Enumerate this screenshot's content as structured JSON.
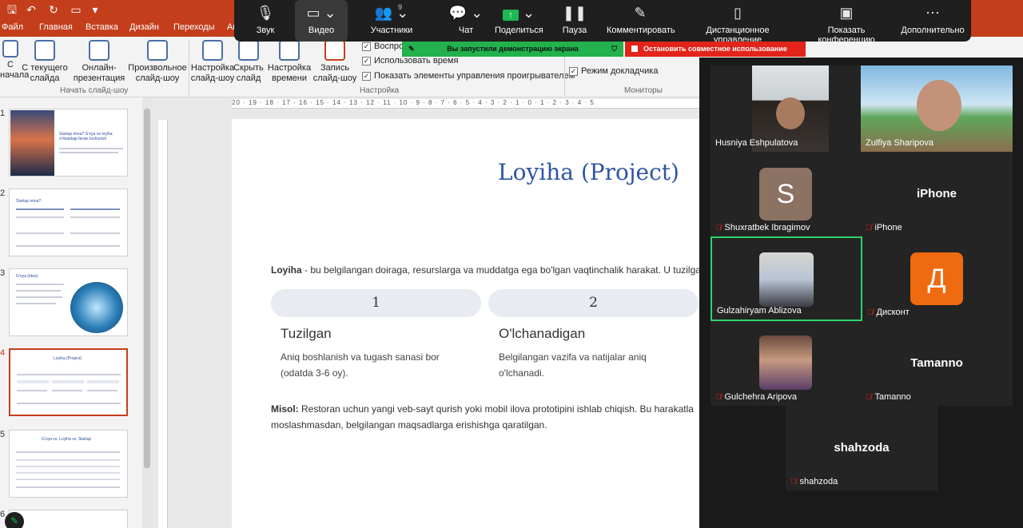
{
  "colors": {
    "accent": "#c43e1c",
    "zoom_green": "#22b14c",
    "zoom_red": "#e2241a",
    "slide_title": "#2f55a4"
  },
  "tabs": [
    "Файл",
    "Главная",
    "Вставка",
    "Дизайн",
    "Переходы",
    "Ан"
  ],
  "ribbon": {
    "from_start": "С\nначала",
    "from_current": "С текущего\nслайда",
    "online": "Онлайн-\nпрезентация",
    "custom": "Произвольное\nслайд-шоу",
    "setup": "Настройка\nслайд-шоу",
    "hide": "Скрыть\nслайд",
    "rehearse": "Настройка\nвремени",
    "record": "Запись\nслайд-шоу",
    "group_start": "Начать слайд-шоу",
    "group_setup": "Настройка",
    "group_monitors": "Мониторы",
    "chk_play": "Воспро",
    "chk_timings": "Использовать время",
    "chk_controls": "Показать элементы управления проигрывателем",
    "chk_presenter": "Режим докладчика"
  },
  "zoom": {
    "sound": "Звук",
    "video": "Видео",
    "participants": "Участники",
    "participants_count": "9",
    "chat": "Чат",
    "share": "Поделиться",
    "pause": "Пауза",
    "annotate": "Комментировать",
    "remote": "Дистанционное управление",
    "show_conf": "Показать конференцию",
    "more": "Дополнительно",
    "sharing_banner": "Вы запустили демонстрацию экрана",
    "stop_banner": "Остановить совместное использование"
  },
  "ruler_h": "20 · 19 · 18 · 17 · 16 · 15 · 14 · 13 · 12 · 11 · 10 · 9 · 8 · 7 · 6 · 5 · 4 · 3 · 2 · 1 · 0 · 1 · 2 · 3 · 4 · 5",
  "thumbnails": [
    {
      "num": "1",
      "title": "Startap nima? G'oya va loyiha o'rtasidagi farqni tushunish"
    },
    {
      "num": "2",
      "title": "Startap nima?"
    },
    {
      "num": "3",
      "title": "G'oya (Idea)"
    },
    {
      "num": "4",
      "title": "Loyiha (Project)"
    },
    {
      "num": "5",
      "title": "G'oya vs. Loyiha vs. Startap"
    },
    {
      "num": "6",
      "title": ""
    }
  ],
  "slide": {
    "title": "Loyiha (Project)",
    "def_bold": "Loyiha",
    "def_rest": " - bu belgilangan doiraga, resurslarga va muddatga ega bo'lgan vaqtinchalik harakat. U tuzilga",
    "col1_num": "1",
    "col2_num": "2",
    "col1_head": "Tuzilgan",
    "col2_head": "O'lchanadigan",
    "col1_line1": "Aniq boshlanish va tugash sanasi bor",
    "col1_line2": "(odatda 3-6 oy).",
    "col2_line1": "Belgilangan vazifa va natijalar aniq",
    "col2_line2": "o'lchanadi.",
    "ex_bold": "Misol:",
    "ex_line1": " Restoran uchun yangi veb-sayt qurish yoki mobil ilova prototipini ishlab chiqish. Bu harakatla",
    "ex_line2": "moslashmasdan, belgilangan maqsadlarga erishishga qaratilgan."
  },
  "participants": [
    {
      "name": "Husniya Eshpulatova"
    },
    {
      "name": "Zulfiya Sharipova"
    },
    {
      "name": "Shuxratbek Ibragimov",
      "letter": "S"
    },
    {
      "name": "iPhone",
      "big": "iPhone"
    },
    {
      "name": "Gulzahiryam Ablizova"
    },
    {
      "name": "Дисконт",
      "letter": "Д"
    },
    {
      "name": "Gulchehra Aripova"
    },
    {
      "name": "Tamanno",
      "big": "Tamanno"
    },
    {
      "name": "shahzoda",
      "big": "shahzoda"
    }
  ]
}
